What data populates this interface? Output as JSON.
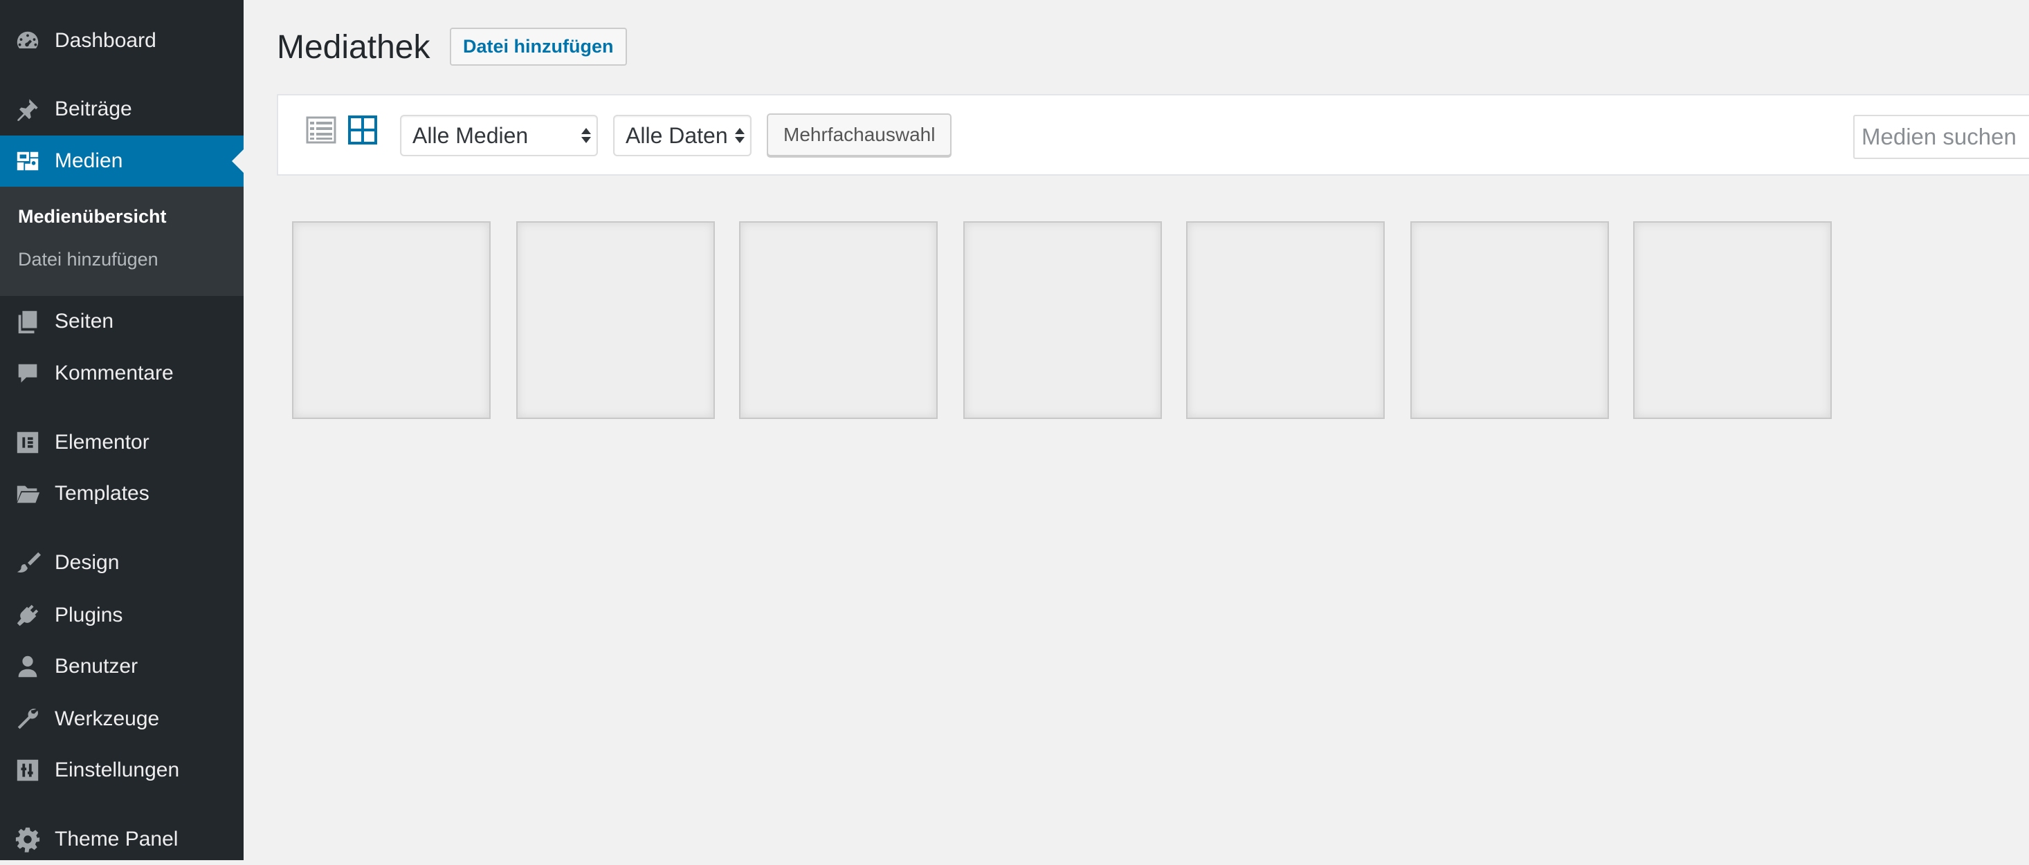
{
  "sidebar": {
    "items": [
      {
        "label": "Dashboard",
        "icon": "dashboard-icon"
      },
      {
        "label": "Beiträge",
        "icon": "pin-icon"
      },
      {
        "label": "Medien",
        "icon": "media-icon",
        "active": true
      },
      {
        "label": "Seiten",
        "icon": "pages-icon"
      },
      {
        "label": "Kommentare",
        "icon": "comment-icon"
      },
      {
        "label": "Elementor",
        "icon": "elementor-icon"
      },
      {
        "label": "Templates",
        "icon": "folder-icon"
      },
      {
        "label": "Design",
        "icon": "brush-icon"
      },
      {
        "label": "Plugins",
        "icon": "plugin-icon"
      },
      {
        "label": "Benutzer",
        "icon": "user-icon"
      },
      {
        "label": "Werkzeuge",
        "icon": "wrench-icon"
      },
      {
        "label": "Einstellungen",
        "icon": "settings-sliders-icon"
      },
      {
        "label": "Theme Panel",
        "icon": "gear-icon"
      }
    ],
    "submenu": [
      {
        "label": "Medienübersicht",
        "current": true
      },
      {
        "label": "Datei hinzufügen"
      }
    ]
  },
  "main": {
    "title": "Mediathek",
    "add_button_label": "Datei hinzufügen"
  },
  "toolbar": {
    "view_modes": [
      "list-view-icon",
      "grid-view-icon"
    ],
    "active_view": "grid-view-icon",
    "media_filter": {
      "selected": "Alle Medien"
    },
    "date_filter": {
      "selected": "Alle Daten"
    },
    "bulk_select_label": "Mehrfachauswahl",
    "search_placeholder": "Medien suchen"
  },
  "media_grid": {
    "tiles": 7
  },
  "colors": {
    "sidebar_bg": "#23282d",
    "submenu_bg": "#32373c",
    "active_blue": "#0073aa",
    "page_bg": "#f1f1f1"
  }
}
